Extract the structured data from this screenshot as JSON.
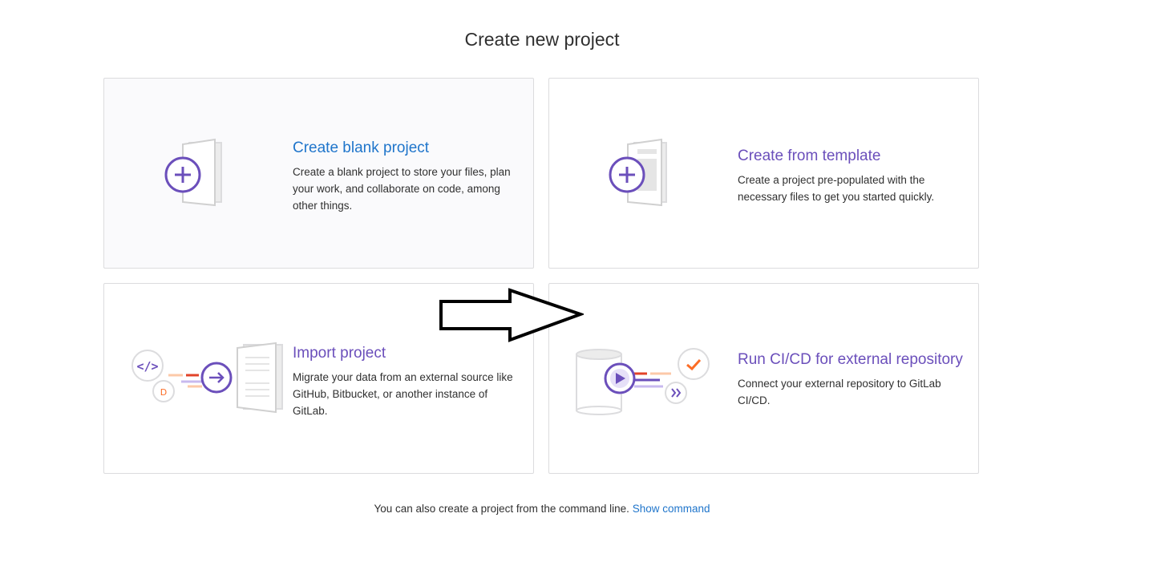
{
  "title": "Create new project",
  "cards": [
    {
      "title": "Create blank project",
      "description": "Create a blank project to store your files, plan your work, and collaborate on code, among other things.",
      "icon": "blank-project-illustration"
    },
    {
      "title": "Create from template",
      "description": "Create a project pre-populated with the necessary files to get you started quickly.",
      "icon": "template-project-illustration"
    },
    {
      "title": "Import project",
      "description": "Migrate your data from an external source like GitHub, Bitbucket, or another instance of GitLab.",
      "icon": "import-project-illustration"
    },
    {
      "title": "Run CI/CD for external repository",
      "description": "Connect your external repository to GitLab CI/CD.",
      "icon": "cicd-project-illustration"
    }
  ],
  "footer": {
    "text": "You can also create a project from the command line.",
    "link": "Show command"
  },
  "colors": {
    "purple": "#6b4fbb",
    "link_blue": "#1f75cb",
    "orange": "#e24329"
  }
}
